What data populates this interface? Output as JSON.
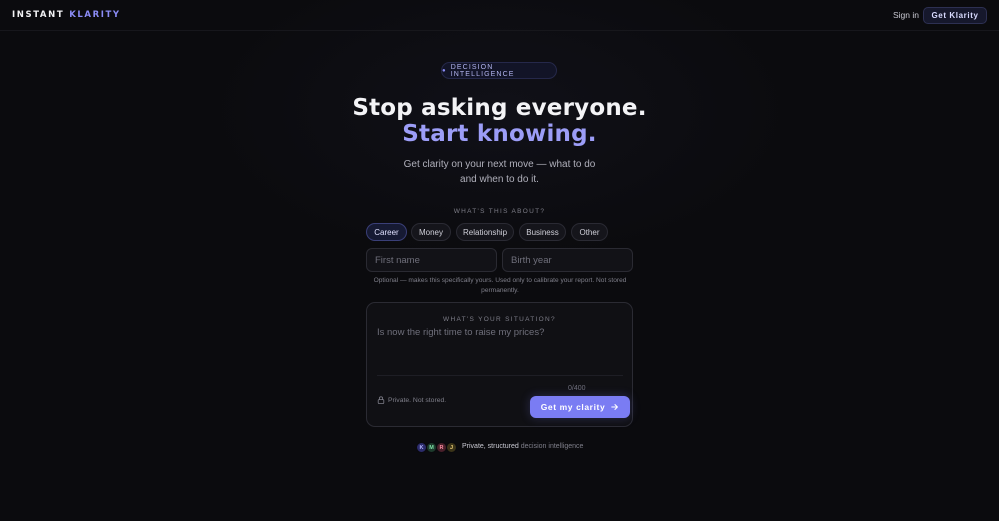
{
  "header": {
    "logo_primary": "INSTANT",
    "logo_accent": "KLARITY",
    "signin_label": "Sign in",
    "cta_label": "Get Klarity"
  },
  "badge": {
    "dot": "●",
    "label": "DECISION INTELLIGENCE"
  },
  "hero": {
    "line1": "Stop asking everyone.",
    "line2": "Start knowing.",
    "subtitle": "Get clarity on your next move — what to do and when to do it."
  },
  "topic": {
    "label": "WHAT'S THIS ABOUT?",
    "options": [
      "Career",
      "Money",
      "Relationship",
      "Business",
      "Other"
    ],
    "selected": "Career"
  },
  "form": {
    "first_name_placeholder": "First name",
    "birth_year_placeholder": "Birth year",
    "note": "Optional — makes this specifically yours.   Used only to calibrate your report. Not stored permanently."
  },
  "situation": {
    "label": "WHAT'S YOUR SITUATION?",
    "placeholder": "Is now the right time to raise my prices?",
    "counter": "0/400",
    "privacy": "Private. Not stored.",
    "submit_label": "Get my clarity",
    "submit_icon": "arrow-right-icon"
  },
  "social_proof": {
    "avatars": [
      {
        "initial": "K",
        "bg": "#2b2b6b",
        "fg": "#b6b8ff"
      },
      {
        "initial": "M",
        "bg": "#1d3b2c",
        "fg": "#7fe0a6"
      },
      {
        "initial": "R",
        "bg": "#4a1f2a",
        "fg": "#ff8fa3"
      },
      {
        "initial": "J",
        "bg": "#3b3418",
        "fg": "#f2d27a"
      }
    ],
    "strong_text": "Private, structured",
    "muted_text": "decision intelligence"
  },
  "colors": {
    "accent": "#7a7cf3",
    "accent_text": "#9c9df7",
    "background": "#0b0b0e"
  }
}
